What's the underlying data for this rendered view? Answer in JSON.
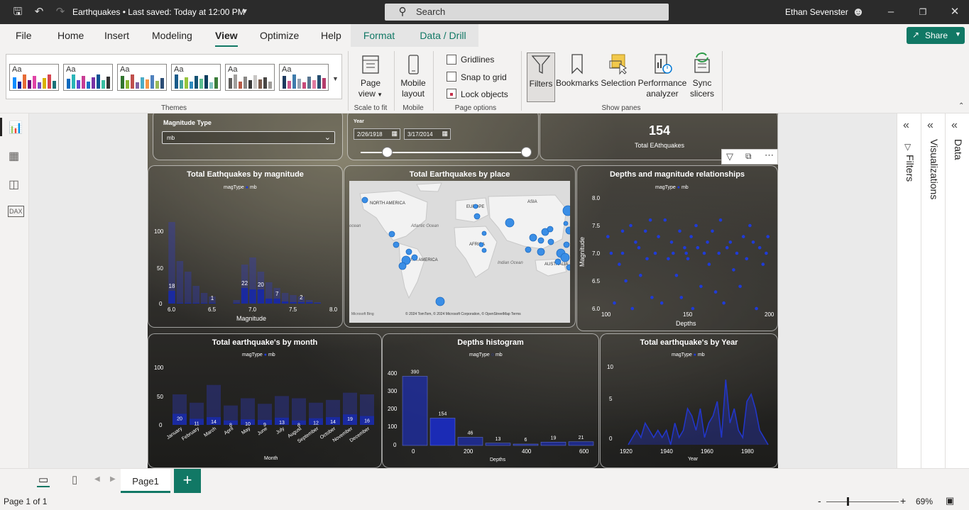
{
  "titlebar": {
    "doc_title": "Earthquakes • Last saved: Today at 12:00 PM",
    "search_placeholder": "Search",
    "user_name": "Ethan Sevenster"
  },
  "menu": {
    "items": [
      "File",
      "Home",
      "Insert",
      "Modeling",
      "View",
      "Optimize",
      "Help"
    ],
    "active": "View",
    "context_tabs": [
      "Format",
      "Data / Drill"
    ],
    "share_label": "Share"
  },
  "ribbon": {
    "themes_label": "Themes",
    "theme_glyph": "Aa",
    "page_view": {
      "label1": "Page",
      "label2": "view",
      "group": "Scale to fit"
    },
    "mobile": {
      "label1": "Mobile",
      "label2": "layout",
      "group": "Mobile"
    },
    "page_options": {
      "gridlines": "Gridlines",
      "snap": "Snap to grid",
      "lock": "Lock objects",
      "group": "Page options"
    },
    "panes": {
      "filters": "Filters",
      "bookmarks": "Bookmarks",
      "selection": "Selection",
      "performance1": "Performance",
      "performance2": "analyzer",
      "sync1": "Sync",
      "sync2": "slicers",
      "group": "Show panes"
    }
  },
  "report": {
    "slicer_mag": {
      "title": "Magnitude Type",
      "value": "mb"
    },
    "slicer_year": {
      "title": "Year",
      "start": "2/26/1918",
      "end": "3/17/2014"
    },
    "kpi": {
      "value": "154",
      "label": "Total EAthquakes"
    },
    "legend_field": "magType",
    "legend_value": "mb",
    "mag_chart": {
      "title": "Total Eathquakes by magnitude",
      "xlabel": "Magnitude",
      "ytick_labels": [
        "100",
        "50",
        "0"
      ],
      "xtick_labels": [
        "6.0",
        "6.5",
        "7.0",
        "7.5",
        "8.0"
      ],
      "data_labels": [
        "18",
        "1",
        "22",
        "20",
        "7",
        "2"
      ]
    },
    "map": {
      "title": "Total Earthquakes by place",
      "labels": [
        "NORTH AMERICA",
        "EUROPE",
        "ASIA",
        "Atlantic Ocean",
        "AFRICA",
        "SOUTH AMERICA",
        "Indian Ocean",
        "AUSTRALIA",
        "ocean"
      ],
      "credit": "© 2024 TomTom, © 2024 Microsoft Corporation, © OpenStreetMap  Terms",
      "logo": "Microsoft Bing"
    },
    "scatter": {
      "title": "Depths and magnitude relationships",
      "xlabel": "Depths",
      "ylabel": "Magnitude",
      "ytick_labels": [
        "8.0",
        "7.5",
        "7.0",
        "6.5",
        "6.0"
      ],
      "xtick_labels": [
        "100",
        "150",
        "200"
      ]
    },
    "month_chart": {
      "title": "Total earthquake's by month",
      "xlabel": "Month",
      "ytick_labels": [
        "100",
        "50",
        "0"
      ]
    },
    "depth_hist": {
      "title": "Depths histogram",
      "xlabel": "Depths",
      "ytick_labels": [
        "400",
        "300",
        "200",
        "100",
        "0"
      ],
      "xtick_labels": [
        "0",
        "200",
        "400",
        "600"
      ]
    },
    "year_chart": {
      "title": "Total earthquake's by Year",
      "xlabel": "Year",
      "ytick_labels": [
        "10",
        "5",
        "0"
      ],
      "xtick_labels": [
        "1920",
        "1940",
        "1960",
        "1980"
      ]
    }
  },
  "panes": {
    "filters": "Filters",
    "visualizations": "Visualizations",
    "data": "Data"
  },
  "tabs": {
    "page": "Page1",
    "add": "+"
  },
  "status": {
    "page_info": "Page 1 of 1",
    "zoom": "69%"
  },
  "colors": {
    "accent": "#117865",
    "bar": "#1a2aa0",
    "dot": "#1f3bd8",
    "map_bubble": "#3a8ee6"
  },
  "chart_data": [
    {
      "type": "bar",
      "title": "Total Eathquakes by magnitude",
      "xlabel": "Magnitude",
      "legend": [
        "mb"
      ],
      "x": [
        6.0,
        6.1,
        6.2,
        6.3,
        6.4,
        6.5,
        6.6,
        6.7,
        6.8,
        6.9,
        7.0,
        7.1,
        7.2,
        7.3,
        7.4,
        7.5,
        7.6,
        7.7,
        7.8
      ],
      "series": [
        {
          "name": "mb",
          "values": [
            18,
            1,
            1,
            1,
            1,
            1,
            0,
            0,
            1,
            22,
            20,
            20,
            7,
            7,
            3,
            2,
            2,
            2,
            1
          ]
        }
      ],
      "background_bars": [
        115,
        60,
        45,
        25,
        15,
        10,
        0,
        0,
        5,
        55,
        65,
        45,
        30,
        22,
        15,
        12,
        10,
        5,
        2
      ],
      "ylim": [
        0,
        130
      ]
    },
    {
      "type": "scatter",
      "title": "Depths and magnitude relationships",
      "xlabel": "Depths",
      "ylabel": "Magnitude",
      "xlim": [
        100,
        200
      ],
      "ylim": [
        6.0,
        8.0
      ],
      "points": [
        [
          101,
          7.3
        ],
        [
          103,
          7.0
        ],
        [
          105,
          6.1
        ],
        [
          108,
          6.8
        ],
        [
          110,
          7.4
        ],
        [
          110,
          7.0
        ],
        [
          112,
          6.5
        ],
        [
          115,
          7.5
        ],
        [
          116,
          6.0
        ],
        [
          118,
          7.2
        ],
        [
          120,
          7.1
        ],
        [
          121,
          6.6
        ],
        [
          124,
          7.4
        ],
        [
          125,
          6.9
        ],
        [
          127,
          7.6
        ],
        [
          128,
          6.2
        ],
        [
          130,
          7.0
        ],
        [
          132,
          7.3
        ],
        [
          134,
          6.1
        ],
        [
          136,
          7.6
        ],
        [
          138,
          6.9
        ],
        [
          140,
          7.2
        ],
        [
          141,
          7.0
        ],
        [
          143,
          6.6
        ],
        [
          145,
          7.4
        ],
        [
          146,
          6.2
        ],
        [
          148,
          7.1
        ],
        [
          149,
          7.0
        ],
        [
          150,
          6.9
        ],
        [
          152,
          7.3
        ],
        [
          153,
          6.0
        ],
        [
          155,
          7.5
        ],
        [
          156,
          7.1
        ],
        [
          158,
          6.4
        ],
        [
          160,
          7.0
        ],
        [
          162,
          7.2
        ],
        [
          163,
          6.8
        ],
        [
          165,
          7.4
        ],
        [
          167,
          6.3
        ],
        [
          169,
          7.0
        ],
        [
          170,
          7.6
        ],
        [
          172,
          6.1
        ],
        [
          174,
          7.1
        ],
        [
          176,
          7.2
        ],
        [
          178,
          6.7
        ],
        [
          180,
          7.0
        ],
        [
          182,
          6.4
        ],
        [
          184,
          7.3
        ],
        [
          186,
          6.9
        ],
        [
          188,
          7.5
        ],
        [
          190,
          7.2
        ],
        [
          192,
          6.0
        ],
        [
          194,
          7.1
        ],
        [
          196,
          6.8
        ],
        [
          198,
          7.0
        ],
        [
          199,
          7.3
        ]
      ]
    },
    {
      "type": "bar",
      "title": "Total earthquake's by month",
      "xlabel": "Month",
      "categories": [
        "January",
        "February",
        "March",
        "April",
        "May",
        "June",
        "July",
        "August",
        "September",
        "October",
        "November",
        "December"
      ],
      "series": [
        {
          "name": "mb",
          "values": [
            20,
            11,
            14,
            8,
            10,
            9,
            13,
            8,
            12,
            14,
            19,
            16
          ]
        }
      ],
      "background_bars": [
        55,
        40,
        72,
        35,
        48,
        38,
        52,
        48,
        40,
        45,
        58,
        55
      ],
      "ylim": [
        0,
        110
      ]
    },
    {
      "type": "bar",
      "title": "Depths histogram",
      "xlabel": "Depths",
      "categories": [
        "0-100",
        "100-200",
        "200-300",
        "300-400",
        "400-500",
        "500-600",
        "600-700"
      ],
      "series": [
        {
          "name": "mb",
          "values": [
            390,
            154,
            46,
            13,
            6,
            19,
            21
          ]
        }
      ],
      "ylim": [
        0,
        420
      ]
    },
    {
      "type": "area",
      "title": "Total earthquake's by Year",
      "xlabel": "Year",
      "xlim": [
        1915,
        1987
      ],
      "ylim": [
        0,
        11
      ],
      "x": [
        1918,
        1920,
        1922,
        1924,
        1926,
        1928,
        1930,
        1932,
        1934,
        1936,
        1938,
        1940,
        1942,
        1944,
        1946,
        1948,
        1950,
        1952,
        1954,
        1956,
        1958,
        1960,
        1962,
        1964,
        1966,
        1968,
        1970,
        1972,
        1974,
        1976,
        1978,
        1980,
        1982,
        1984
      ],
      "series": [
        {
          "name": "mb",
          "values": [
            0,
            1,
            2,
            1,
            3,
            2,
            1,
            2,
            1,
            2,
            0,
            3,
            1,
            2,
            5,
            4,
            2,
            5,
            1,
            3,
            4,
            6,
            1,
            9,
            3,
            5,
            2,
            1,
            6,
            7,
            5,
            2,
            1,
            0
          ]
        }
      ]
    }
  ]
}
